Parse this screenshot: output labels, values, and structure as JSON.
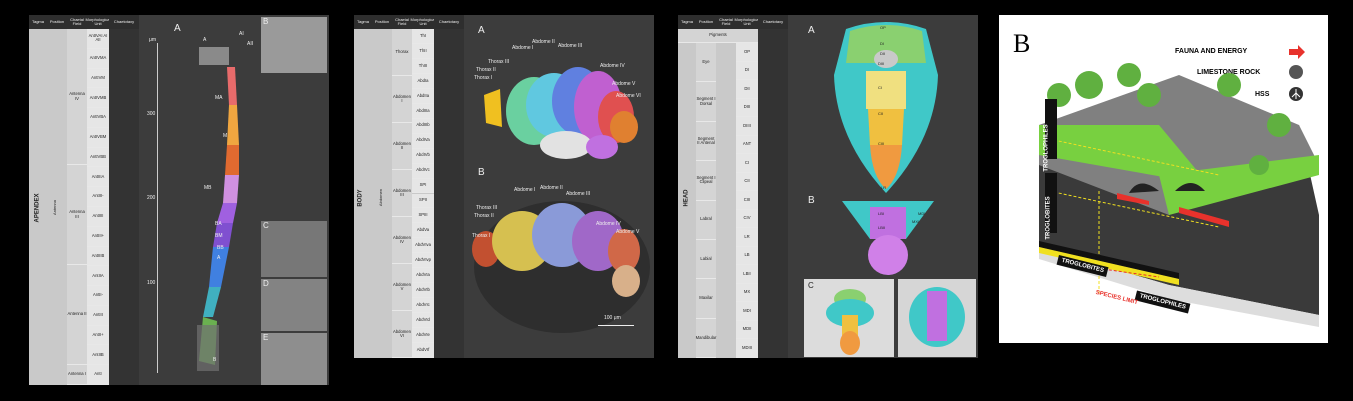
{
  "panel1": {
    "headers": [
      "Tagma",
      "Position",
      "Chaetal Field",
      "Morphological Unit",
      "Chaetotaxy"
    ],
    "tagma": "APENDEX",
    "position": "Antenna",
    "fields": [
      "Antenna IV",
      "Antenna III",
      "Antenna II",
      "Antenna I"
    ],
    "units": [
      "AntIVAI AI AII",
      "AntIVMA",
      "AntIVM",
      "AntIVMB",
      "AntIVBA",
      "AntIVBM",
      "AntIVBB",
      "AntIIIA",
      "AntIII-",
      "AntIIII",
      "AntIII+",
      "AntIIIB",
      "AntIIA",
      "AntII-",
      "AntIII",
      "AntII+",
      "AntIIB",
      "AntI"
    ],
    "fig_label": "A",
    "fig_label_b": "B",
    "fig_label_c": "C",
    "fig_label_d": "D",
    "fig_label_e": "E",
    "scale_unit": "μm",
    "scale_ticks": [
      "300",
      "200",
      "100"
    ],
    "segment_labels": [
      "MA",
      "M",
      "MB",
      "BA",
      "BM",
      "BB",
      "A",
      "B"
    ],
    "tip_labels": [
      "AI",
      "AII",
      "A"
    ]
  },
  "panel2": {
    "headers": [
      "Tagma",
      "Position",
      "Chaetal Field",
      "Morphological Unit",
      "Chaetotaxy"
    ],
    "tagma": "BODY",
    "position": "Abdomen",
    "fields": [
      "Thorax",
      "Abdomen I",
      "Abdomen II",
      "Abdomen III",
      "Abdomen IV",
      "Abdomen V",
      "Abdomen VI"
    ],
    "units": [
      "ThI",
      "ThII",
      "ThIII",
      "AbdIa",
      "AbdIIa",
      "AbdIIIa",
      "AbdIIIb",
      "AbdIVa",
      "AbdIVb",
      "AbdIVc",
      "SPI",
      "SPII",
      "SPIII",
      "AbdVa",
      "AbdVIva",
      "AbdVIvp",
      "AbdVIa",
      "AbdVIb",
      "AbdVIc",
      "AbdVId",
      "AbdVIe",
      "AbdVIf"
    ],
    "fig_label_a": "A",
    "fig_label_b": "B",
    "labels_a": [
      "Abdome I",
      "Abdome II",
      "Abdome III",
      "Abdome IV",
      "Abdome V",
      "Thorax I",
      "Thorax II",
      "Thorax III",
      "Abdome VI"
    ],
    "labels_b": [
      "Abdome I",
      "Abdome II",
      "Abdome III",
      "Abdome IV",
      "Abdome V",
      "Thorax I",
      "Thorax II",
      "Thorax III"
    ],
    "scale": "100 μm"
  },
  "panel3": {
    "headers": [
      "Tagma",
      "Position",
      "Chaetal Field",
      "Morphological Unit",
      "Chaetotaxy"
    ],
    "tagma": "HEAD",
    "pigments": "Pigments",
    "fields": [
      "Eye",
      "Segment I Dorsal",
      "Segment II Antenal",
      "Segment I Clipeal",
      "Labral",
      "Labial",
      "Maxilar",
      "Mandibular"
    ],
    "units": [
      "OP",
      "DI",
      "DII",
      "DIII",
      "DIIII",
      "ANT",
      "CI",
      "CII",
      "CIII",
      "CIV",
      "LR",
      "LB",
      "LBII",
      "MX",
      "MDI",
      "MDII",
      "MDIII"
    ],
    "fig_label_a": "A",
    "fig_label_b": "B",
    "fig_label_c": "C",
    "head_labels": [
      "OP",
      "DI",
      "DII",
      "DIII",
      "CI",
      "CII",
      "CIII",
      "LR",
      "LBI",
      "LBII",
      "MXI",
      "MDI"
    ]
  },
  "panel4": {
    "fig_label": "B",
    "legend": [
      {
        "label": "FAUNA AND ENERGY",
        "icon": "arrow-icon",
        "color": "#e8322c"
      },
      {
        "label": "LIMESTONE ROCK",
        "icon": "rock-icon",
        "color": "#555555"
      },
      {
        "label": "HSS",
        "icon": "roots-icon",
        "color": "#333333"
      }
    ],
    "troglophiles_v": "TROGLOPHILES",
    "troglobites_v": "TROGLOBITES",
    "troglobites_h": "TROGLOBITES",
    "troglophiles_h": "TROGLOPHILES",
    "species_limit": "SPECIES LIMIT"
  }
}
